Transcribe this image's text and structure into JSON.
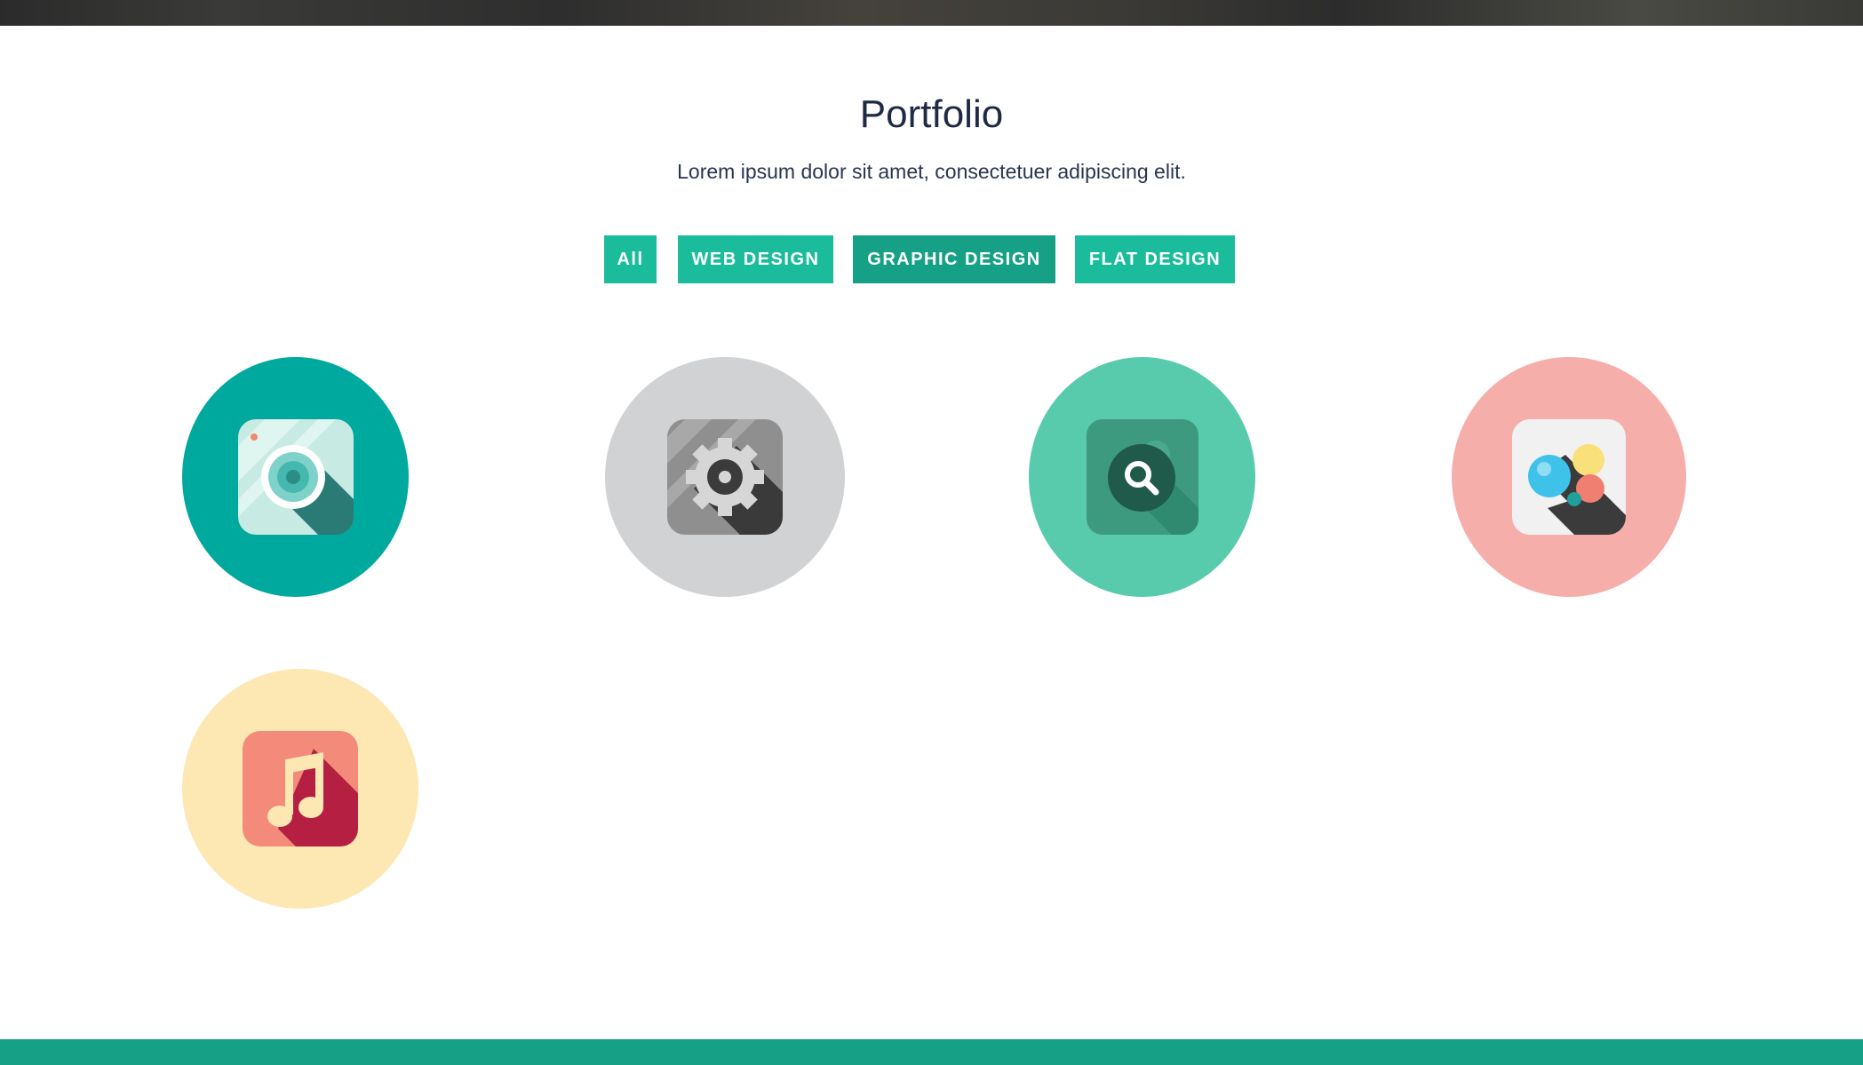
{
  "portfolio": {
    "title": "Portfolio",
    "subtitle": "Lorem ipsum dolor sit amet, consectetuer adipiscing elit."
  },
  "filters": [
    {
      "label": "All",
      "active": false
    },
    {
      "label": "WEB DESIGN",
      "active": false
    },
    {
      "label": "GRAPHIC DESIGN",
      "active": true
    },
    {
      "label": "FLAT DESIGN",
      "active": false
    }
  ],
  "items": [
    {
      "icon": "camera-icon",
      "circle_color": "#00a99d"
    },
    {
      "icon": "gear-icon",
      "circle_color": "#d1d2d4"
    },
    {
      "icon": "magnifier-icon",
      "circle_color": "#58cbad"
    },
    {
      "icon": "bubbles-icon",
      "circle_color": "#f6aeab"
    },
    {
      "icon": "music-icon",
      "circle_color": "#fde8b4"
    }
  ],
  "colors": {
    "accent": "#1abc9c",
    "accent_active": "#16a085",
    "footer": "#16a085",
    "heading": "#1f2a44"
  }
}
